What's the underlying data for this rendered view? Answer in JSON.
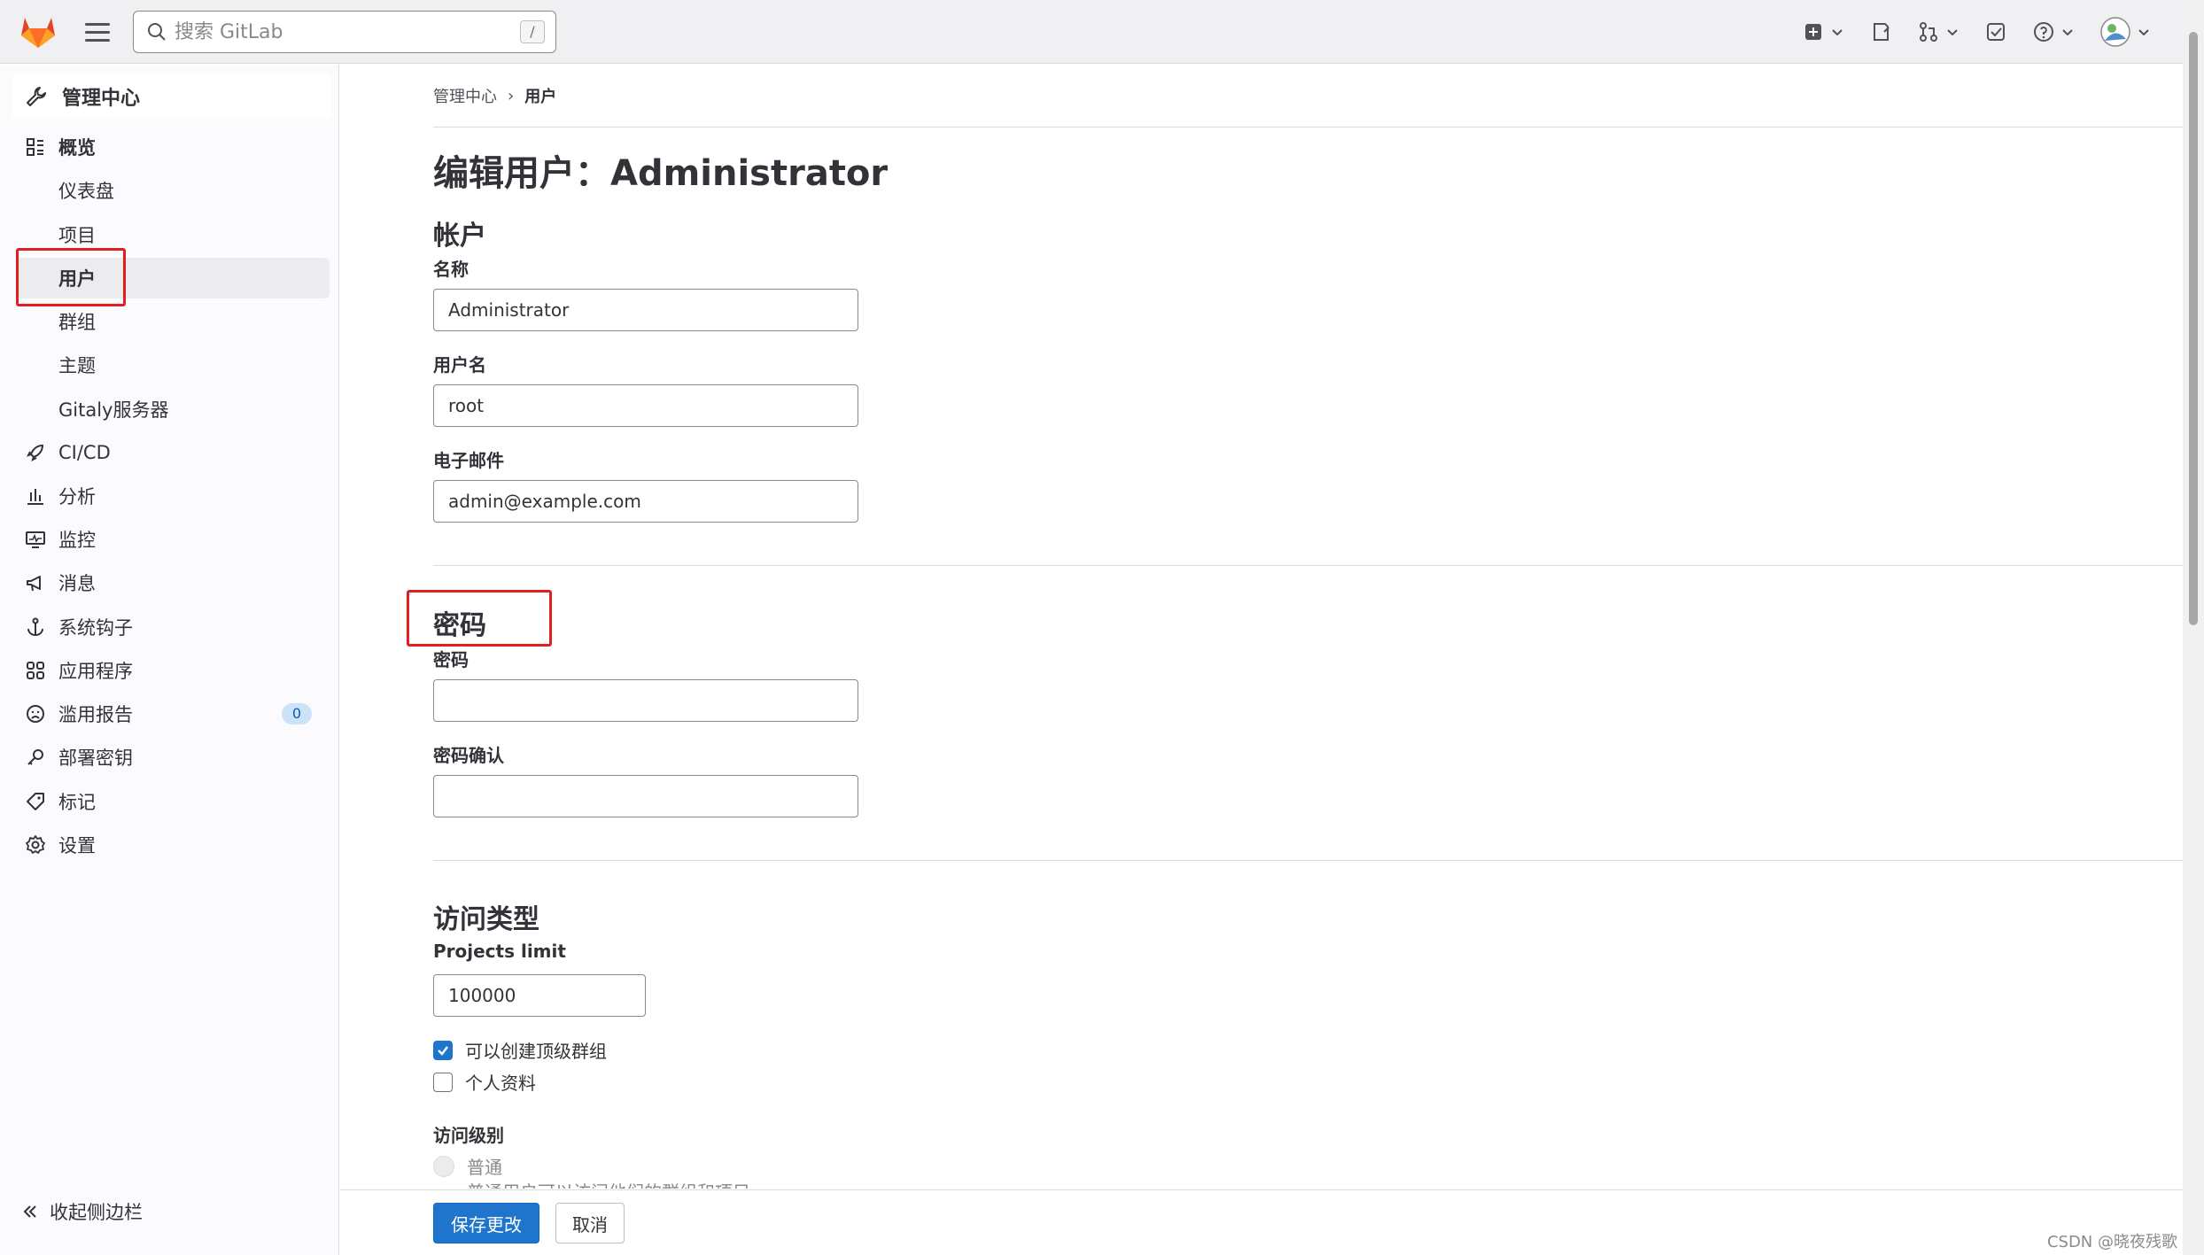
{
  "topbar": {
    "search_placeholder": "搜索 GitLab",
    "search_shortcut": "/"
  },
  "sidebar": {
    "header": "管理中心",
    "overview": "概览",
    "sub_items": [
      "仪表盘",
      "项目",
      "用户",
      "群组",
      "主题",
      "Gitaly服务器"
    ],
    "items": [
      "CI/CD",
      "分析",
      "监控",
      "消息",
      "系统钩子",
      "应用程序",
      "滥用报告",
      "部署密钥",
      "标记",
      "设置"
    ],
    "abuse_badge": "0",
    "collapse": "收起侧边栏"
  },
  "breadcrumb": {
    "root": "管理中心",
    "current": "用户",
    "separator": "›"
  },
  "page_title": "编辑用户：Administrator",
  "account": {
    "title": "帐户",
    "name_label": "名称",
    "name_value": "Administrator",
    "username_label": "用户名",
    "username_value": "root",
    "email_label": "电子邮件",
    "email_value": "admin@example.com"
  },
  "password": {
    "title": "密码",
    "password_label": "密码",
    "confirm_label": "密码确认"
  },
  "access": {
    "title": "访问类型",
    "projects_limit_label": "Projects limit",
    "projects_limit_value": "100000",
    "can_create_group": "可以创建顶级群组",
    "private_profile": "个人资料",
    "access_level_label": "访问级别",
    "regular": "普通",
    "regular_desc": "普通用户可以访问他们的群组和项目"
  },
  "buttons": {
    "save": "保存更改",
    "cancel": "取消"
  },
  "watermark": "CSDN @晓夜残歌"
}
